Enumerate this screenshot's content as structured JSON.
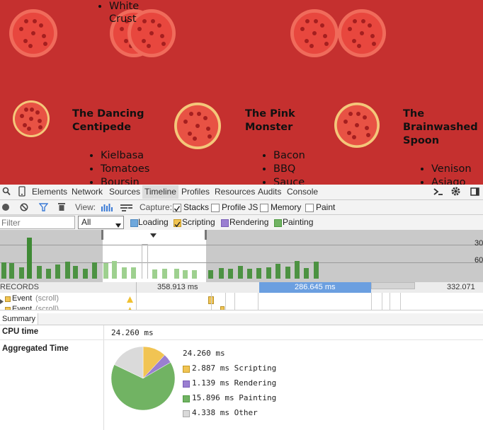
{
  "page": {
    "top_list_item_1": "White",
    "top_list_item_2": "Crust",
    "pizzas": [
      {
        "name_line1": "The Dancing",
        "name_line2": "Centipede",
        "name_line3": "",
        "toppings": [
          "Kielbasa",
          "Tomatoes",
          "Boursin"
        ]
      },
      {
        "name_line1": "The Pink",
        "name_line2": "Monster",
        "name_line3": "",
        "toppings": [
          "Bacon",
          "BBQ",
          "Sauce"
        ]
      },
      {
        "name_line1": "The",
        "name_line2": "Brainwashed",
        "name_line3": "Spoon",
        "toppings": [
          "Venison",
          "Asiago"
        ]
      }
    ]
  },
  "devtools": {
    "tabs": [
      "Elements",
      "Network",
      "Sources",
      "Timeline",
      "Profiles",
      "Resources",
      "Audits",
      "Console"
    ],
    "selected_tab": "Timeline",
    "view_label": "View:",
    "capture_label": "Capture:",
    "capture_options": [
      {
        "label": "Stacks",
        "checked": true
      },
      {
        "label": "Profile JS",
        "checked": false
      },
      {
        "label": "Memory",
        "checked": false
      },
      {
        "label": "Paint",
        "checked": false
      }
    ],
    "filter_placeholder": "Filter",
    "filter_select": "All",
    "categories": [
      {
        "label": "Loading",
        "color": "#6fa8dc",
        "checked": true
      },
      {
        "label": "Scripting",
        "color": "#f1c453",
        "checked": true
      },
      {
        "label": "Rendering",
        "color": "#9a7fd1",
        "checked": true
      },
      {
        "label": "Painting",
        "color": "#71b363",
        "checked": true
      }
    ],
    "overview_scale_1": "30",
    "overview_scale_2": "60",
    "ruler_label": "RECORDS",
    "ruler_time_1": "358.913 ms",
    "ruler_time_2": "286.645 ms",
    "ruler_time_3": "332.071 m",
    "records": [
      {
        "name": "Event",
        "detail": "(scroll)"
      },
      {
        "name": "Event",
        "detail": "(scroll)"
      }
    ],
    "summary_tab": "Summary",
    "cpu_time_label": "CPU time",
    "cpu_time_value": "24.260 ms",
    "aggregated_label": "Aggregated Time",
    "aggregated_total": "24.260 ms",
    "breakdown": [
      {
        "value": "2.887 ms",
        "label": "Scripting",
        "ms": 2.887,
        "color": "#f1c453"
      },
      {
        "value": "1.139 ms",
        "label": "Rendering",
        "ms": 1.139,
        "color": "#9a7fd1"
      },
      {
        "value": "15.896 ms",
        "label": "Painting",
        "ms": 15.896,
        "color": "#71b363"
      },
      {
        "value": "4.338 ms",
        "label": "Other",
        "ms": 4.338,
        "color": "#dadada"
      }
    ]
  }
}
